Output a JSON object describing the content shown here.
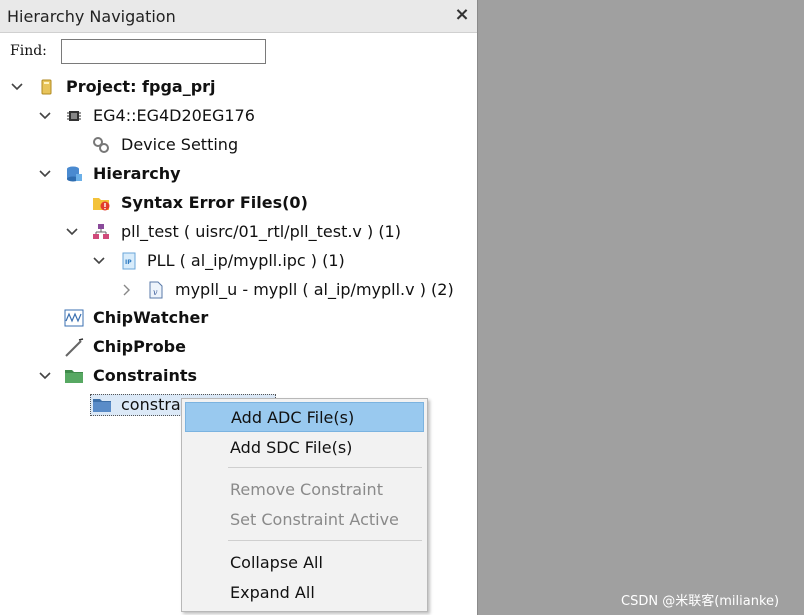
{
  "panel": {
    "title": "Hierarchy Navigation",
    "close_glyph": "×"
  },
  "find": {
    "label": "Find:",
    "value": "",
    "placeholder": ""
  },
  "tree": {
    "project": "Project: fpga_prj",
    "device": "EG4::EG4D20EG176",
    "device_setting": "Device Setting",
    "hierarchy": "Hierarchy",
    "syntax_errors": "Syntax Error Files(0)",
    "pll_test": "pll_test ( uisrc/01_rtl/pll_test.v )  (1)",
    "pll": "PLL ( al_ip/mypll.ipc ) (1)",
    "mypll_u": "mypll_u - mypll ( al_ip/mypll.v )  (2)",
    "chipwatcher": "ChipWatcher",
    "chipprobe": "ChipProbe",
    "constraints": "Constraints",
    "constraints_folder": "constra"
  },
  "context_menu": {
    "add_adc": "Add ADC File(s)",
    "add_sdc": "Add SDC File(s)",
    "remove_constraint": "Remove Constraint",
    "set_constraint_active": "Set Constraint Active",
    "collapse_all": "Collapse All",
    "expand_all": "Expand All"
  },
  "watermark": "CSDN @米联客(milianke)",
  "colors": {
    "panel_bg": "#ffffff",
    "workspace_bg": "#a0a0a0",
    "menu_bg": "#f2f2f2",
    "menu_hover": "#99c9ef",
    "disabled_text": "#8a8a8a"
  }
}
